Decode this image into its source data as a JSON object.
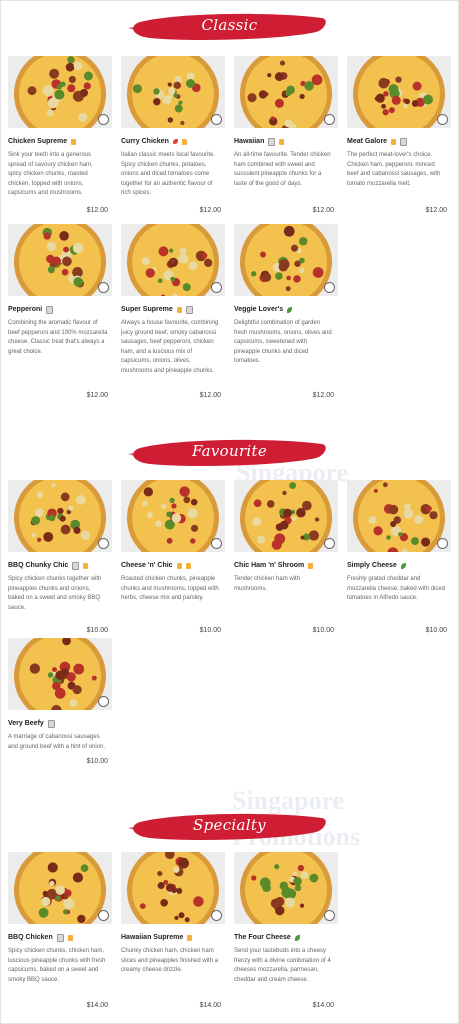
{
  "sections": [
    {
      "title": "Classic",
      "items": [
        {
          "name": "Chicken Supreme",
          "desc": "Sink your teeth into a generous spread of savoury chicken ham, spicy chicken chunks, roasted chicken, topped with onions, capsicums and mushrooms.",
          "price": "$12.00",
          "tags": [
            "porkfree"
          ]
        },
        {
          "name": "Curry Chicken",
          "desc": "Italian classic meets local favourite. Spicy chicken chunks, potatoes, onions and diced tomatoes come together for an authentic flavour of rich spices.",
          "price": "$12.00",
          "tags": [
            "chili",
            "porkfree"
          ]
        },
        {
          "name": "Hawaiian",
          "desc": "An all-time favourite. Tender chicken ham combined with sweet and succulent pineapple chunks for a taste of the good ol' days.",
          "price": "$12.00",
          "tags": [
            "chef",
            "porkfree"
          ]
        },
        {
          "name": "Meat Galore",
          "desc": "The perfect meat-lover's choice. Chicken ham, pepperoni, minced beef and cabanossi sausages, with tomato mozzarella melt.",
          "price": "$12.00",
          "tags": [
            "porkfree",
            "chef"
          ]
        },
        {
          "name": "Pepperoni",
          "desc": "Combining the aromatic flavour of beef pepperoni and 100% mozzarella cheese. Classic treat that's always a great choice.",
          "price": "$12.00",
          "tags": [
            "chef"
          ]
        },
        {
          "name": "Super Supreme",
          "desc": "Always a house favourite, combining juicy ground beef, smoky cabanossi sausages, beef pepperoni, chicken ham, and a luscious mix of capsicums, onions, olives, mushrooms and pineapple chunks.",
          "price": "$12.00",
          "tags": [
            "porkfree",
            "chef"
          ]
        },
        {
          "name": "Veggie Lover's",
          "desc": "Delightful combination of garden fresh mushrooms, onions, olives and capsicums, sweetened with pineapple chunks and diced tomatoes.",
          "price": "$12.00",
          "tags": [
            "leaf"
          ]
        }
      ]
    },
    {
      "title": "Favourite",
      "items": [
        {
          "name": "BBQ Chunky Chic",
          "desc": "Spicy chicken chunks together with pineapples chunks and onions, baked on a sweet and smoky BBQ sauce.",
          "price": "$10.00",
          "tags": [
            "chef",
            "porkfree"
          ]
        },
        {
          "name": "Cheese 'n' Chic",
          "desc": "Roasted chicken chunks, pineapple chunks and mushrooms, topped with herbs, cheese mix and parsley.",
          "price": "$10.00",
          "tags": [
            "porkfree",
            "porkfree"
          ]
        },
        {
          "name": "Chic Ham 'n' Shroom",
          "desc": "Tender chicken ham with mushrooms.",
          "price": "$10.00",
          "tags": [
            "porkfree"
          ]
        },
        {
          "name": "Simply Cheese",
          "desc": "Freshly grated cheddar and mozzarella cheese, baked with diced tomatoes in Alfredo sauce.",
          "price": "$10.00",
          "tags": [
            "leaf"
          ]
        },
        {
          "name": "Very Beefy",
          "desc": "A marriage of cabanossi sausages and ground beef with a hint of onion.",
          "price": "$10.00",
          "tags": [
            "chef"
          ]
        }
      ]
    },
    {
      "title": "Specialty",
      "items": [
        {
          "name": "BBQ Chicken",
          "desc": "Spicy chicken chunks, chicken ham, luscious pineapple chunks with fresh capsicums, baked on a sweet and smoky BBQ sauce.",
          "price": "$14.00",
          "tags": [
            "chef",
            "porkfree"
          ]
        },
        {
          "name": "Hawaiian Supreme",
          "desc": "Chunky chicken ham, chicken ham slices and pineapples finished with a creamy cheese drizzle.",
          "price": "$14.00",
          "tags": [
            "porkfree"
          ]
        },
        {
          "name": "The Four Cheese",
          "desc": "Send your tastebuds into a cheesy frenzy with a divine combination of 4 cheeses mozzarella, parmesan, cheddar and cream cheese.",
          "price": "$14.00",
          "tags": [
            "leaf"
          ]
        }
      ]
    }
  ],
  "watermark": [
    "Singapore",
    "Promotions"
  ],
  "colors": {
    "banner": "#cf1d33",
    "crust": "#d99a3a",
    "cheese": "#f2c14e",
    "pepperoni": "#b8322a"
  }
}
